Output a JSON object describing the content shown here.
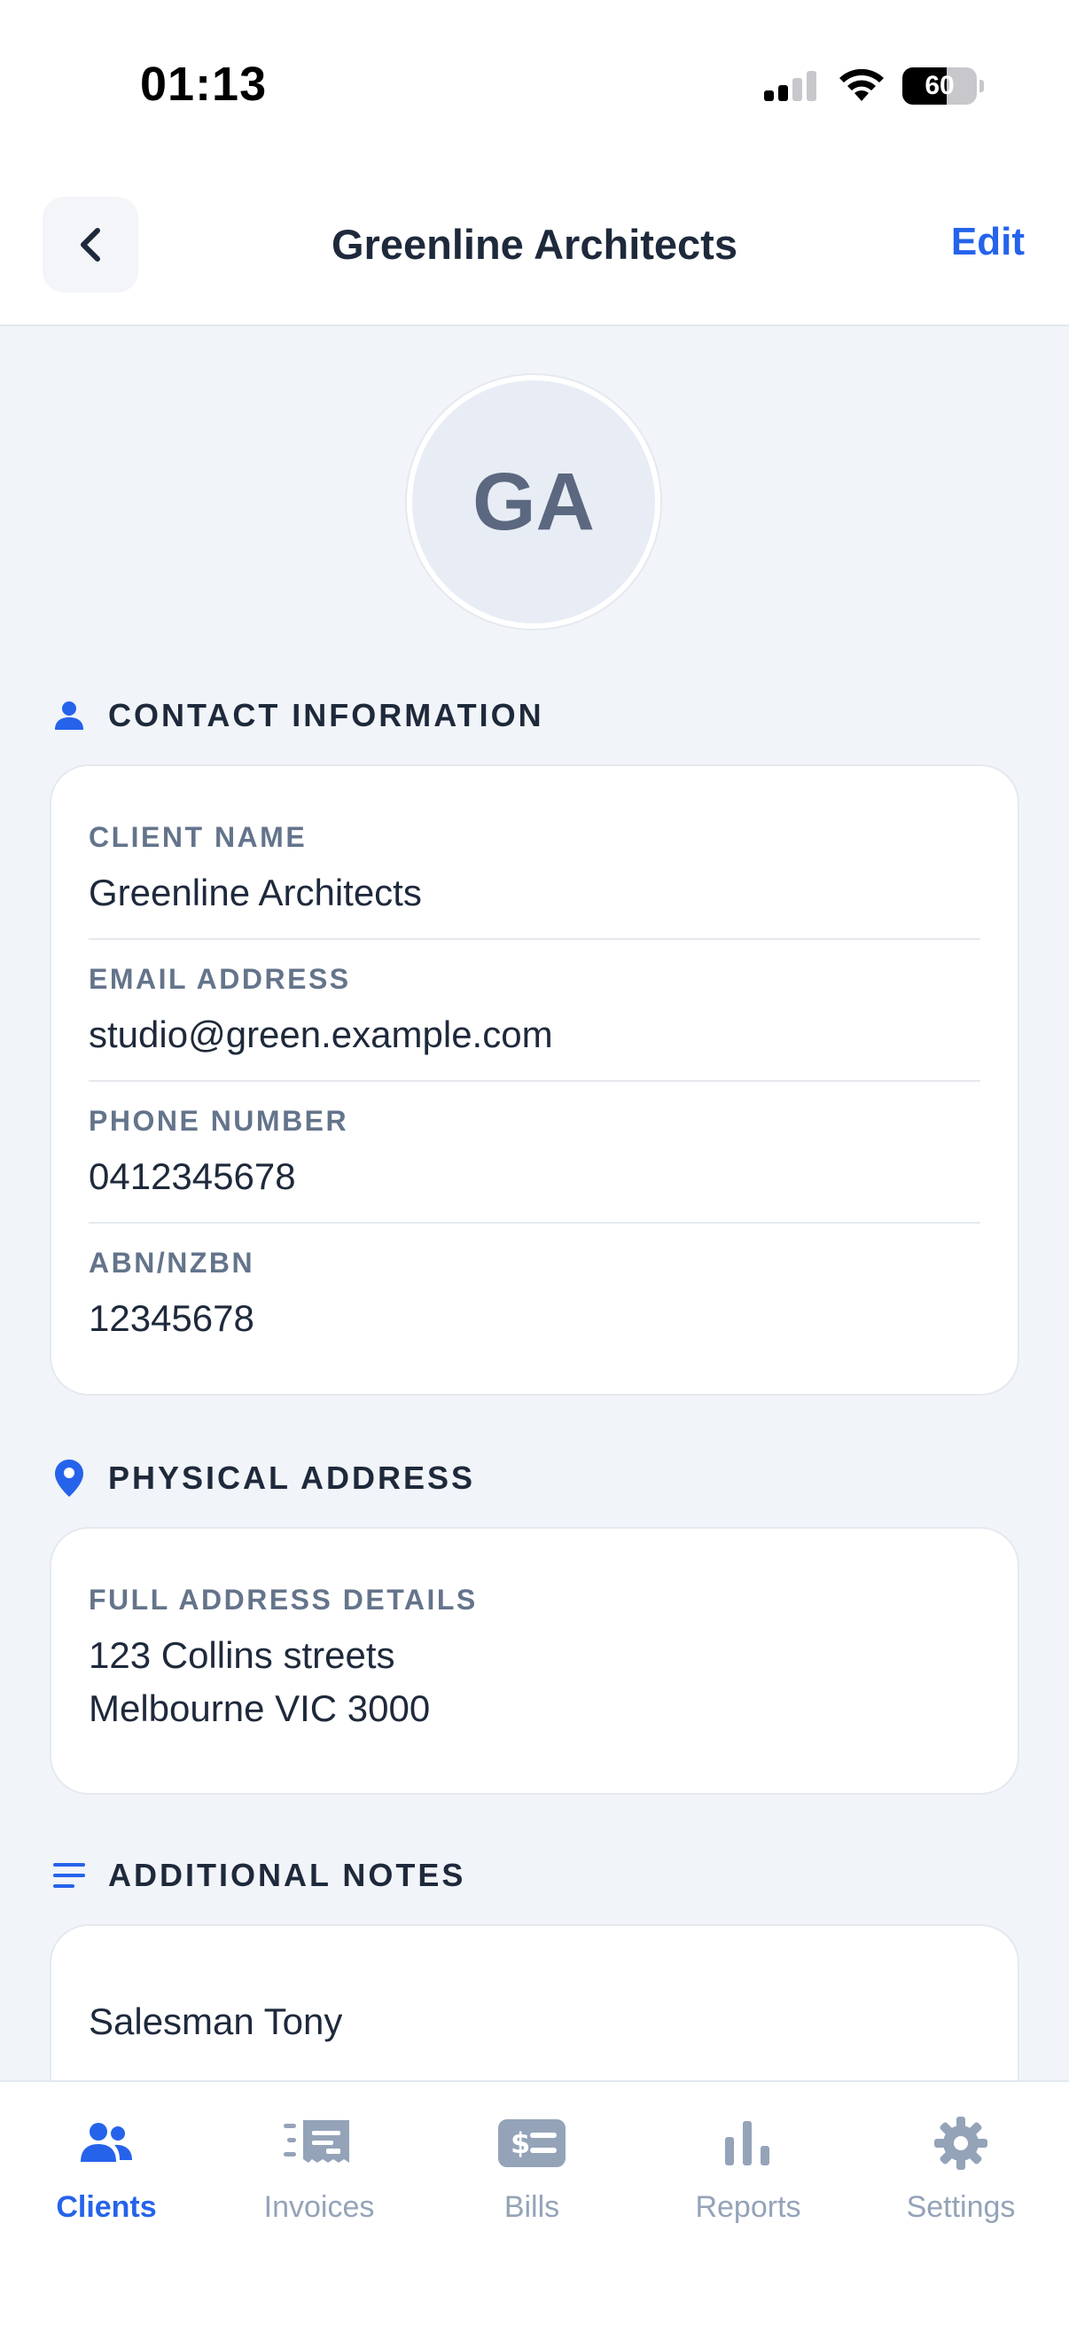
{
  "status_bar": {
    "time": "01:13",
    "battery": "60"
  },
  "nav": {
    "title": "Greenline Architects",
    "edit_label": "Edit"
  },
  "avatar": {
    "initials": "GA"
  },
  "contact": {
    "title": "CONTACT INFORMATION",
    "fields": [
      {
        "label": "CLIENT NAME",
        "value": "Greenline Architects"
      },
      {
        "label": "EMAIL ADDRESS",
        "value": "studio@green.example.com"
      },
      {
        "label": "PHONE NUMBER",
        "value": "0412345678"
      },
      {
        "label": "ABN/NZBN",
        "value": "12345678"
      }
    ]
  },
  "address": {
    "title": "PHYSICAL ADDRESS",
    "label": "FULL ADDRESS DETAILS",
    "line1": "123 Collins streets",
    "line2": "Melbourne VIC 3000"
  },
  "notes": {
    "title": "ADDITIONAL NOTES",
    "value": "Salesman Tony"
  },
  "tabs": [
    {
      "label": "Clients",
      "icon": "users-icon",
      "active": true
    },
    {
      "label": "Invoices",
      "icon": "invoice-icon",
      "active": false
    },
    {
      "label": "Bills",
      "icon": "bill-icon",
      "active": false
    },
    {
      "label": "Reports",
      "icon": "bar-chart-icon",
      "active": false
    },
    {
      "label": "Settings",
      "icon": "gear-icon",
      "active": false
    }
  ],
  "colors": {
    "accent": "#2563eb",
    "inactive": "#94a3b8",
    "background": "#f1f4f8"
  }
}
